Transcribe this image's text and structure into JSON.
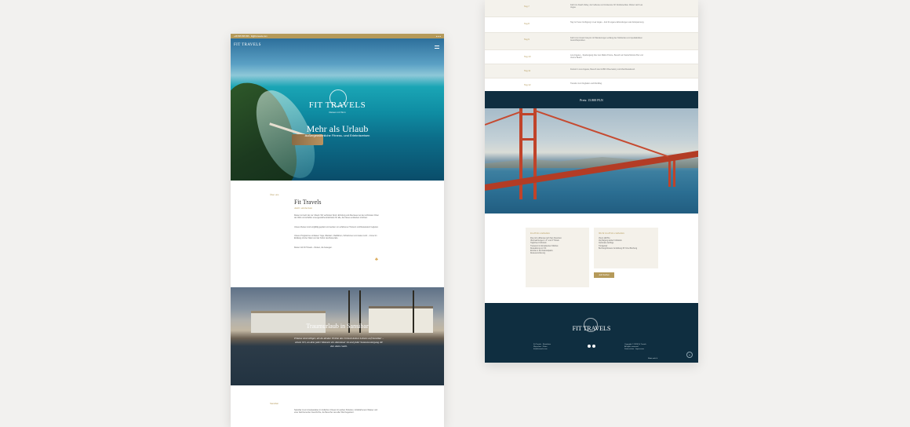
{
  "left": {
    "topbar": {
      "contact": "+48 555 555 555 · fit@fit-travels.com",
      "social": ""
    },
    "hero": {
      "nav_logo": "FIT TRAVELS",
      "logo": "FIT TRAVELS",
      "logo_sub": "Reisen mit Sinn",
      "title": "Mehr als Urlaub",
      "subtitle": "Außergewöhnliche Fitness- und Erlebnisreisen"
    },
    "about": {
      "kicker": "Über uns",
      "title": "Fit Travels",
      "subtitle": "Aktiv entdecken",
      "p1": "Reisen ist mehr als nur Urlaub. Wir verbinden Sport, Erholung und Abenteuer an den schönsten Orten der Welt und schaffen unvergessliche Erlebnisse für alle, die Neues entdecken möchten.",
      "p2": "Unsere Reisen sind sorgfältig geplant und werden von erfahrenen Trainern und Reiseleitern begleitet.",
      "p3": "Unsere Programme umfassen Yoga, Wandern, Radfahren, Schwimmen und vieles mehr – immer im Einklang mit der Natur und der Kultur des Reiseziels.",
      "p4": "Reisen mit Fit Travels – Reisen, die bewegen."
    },
    "house": {
      "title": "Traumurlaub in Sansibar",
      "quote": "Träume sind nötiger, als du denkst. Erlebe den Urlaub deines Lebens auf Sansibar – einem Ort, an dem jeder Moment ein Abenteuer ist und jeder Sonnenuntergang dir den Atem raubt."
    },
    "bottom": {
      "kicker": "Sansibar",
      "p": "Sansibar ist ein Inselparadies im Indischen Ozean mit weißen Stränden, türkisfarbenem Wasser und einer faszinierenden Geschichte, die Besucher aus aller Welt begeistert."
    }
  },
  "right": {
    "itinerary": [
      {
        "day": "Tag 7",
        "text": "Fahrt ins Death Valley, der heißeste und trockenste Ort Nordamerikas. Weiter nach Las Vegas."
      },
      {
        "day": "Tag 8",
        "text": "Tag zur freien Verfügung in Las Vegas – Zeit für eigene Erkundungen oder Entspannung."
      },
      {
        "day": "Tag 9",
        "text": "Fahrt zum Grand Canyon mit Wanderungen entlang des Südrandes und spektakulären Aussichtspunkten."
      },
      {
        "day": "Tag 10",
        "text": "Los Angeles – Spaziergang über den Walk of Fame, Besuch am Santa Monica Pier und Venice Beach."
      },
      {
        "day": "Tag 11",
        "text": "Freizeit in Los Angeles, Besuch des Griffith Observatory und Abschlussabend."
      },
      {
        "day": "Tag 12",
        "text": "Transfer zum Flughafen und Rückflug."
      }
    ],
    "price": "Preis: 15.800 PLN",
    "info_left": {
      "title": "Im Preis enthalten",
      "lines": [
        "Flug mit Lufthansa nach San Francisco",
        "Übernachtungen in 3* und 4* Hotels",
        "Tägliches Frühstück",
        "Transport im klimatisierten Minibus",
        "Reiseleitung vor Ort",
        "Eintritte in die Nationalparks",
        "Reiseversicherung"
      ]
    },
    "info_right": {
      "title": "Nicht im Preis enthalten",
      "lines": [
        "Visum (ESTA)",
        "Verpflegung außer Frühstück",
        "Optionale Ausflüge",
        "Trinkgelder",
        "Buchungshinweis: Anzahlung 30 % bei Buchung"
      ],
      "button": "Jetzt buchen"
    },
    "footer": {
      "logo": "FIT TRAVELS",
      "left": [
        "Fit Travels · Reisebüro",
        "Warschau · Polen",
        "fit@fit-travels.com"
      ],
      "right": [
        "Copyright © 2024 Fit Travels",
        "All rights reserved",
        "Datenschutz · Impressum"
      ],
      "copy": "Made with ♥"
    }
  }
}
